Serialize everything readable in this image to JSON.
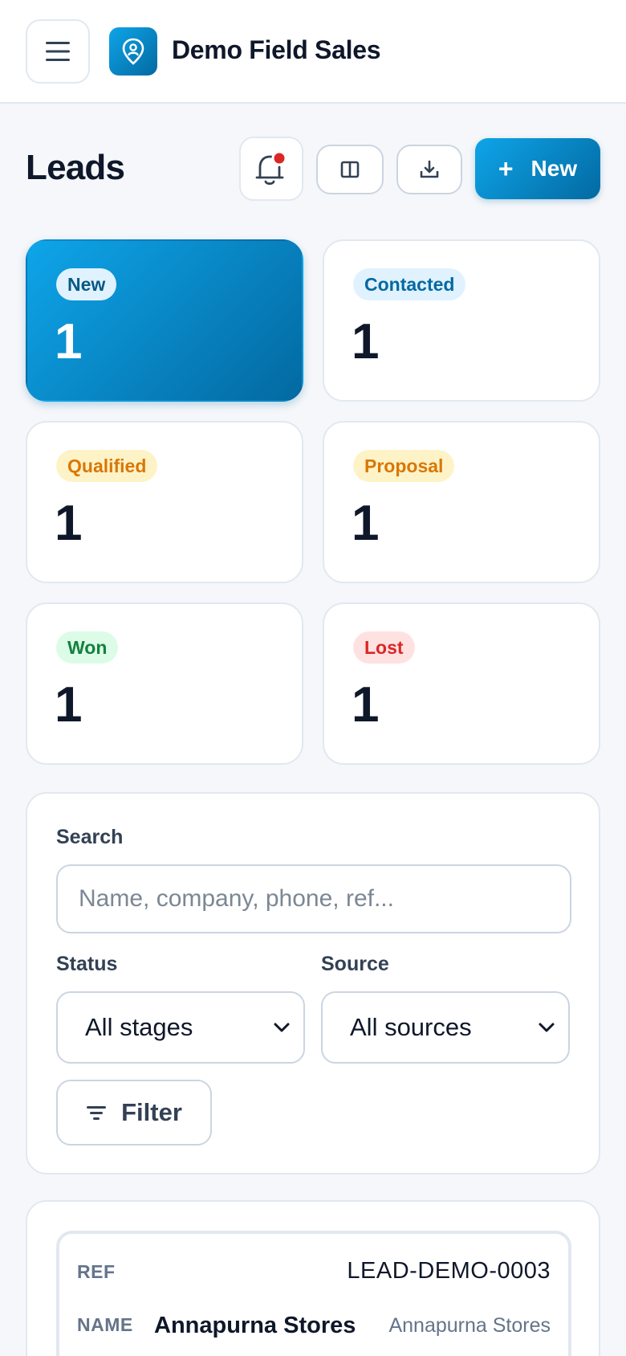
{
  "app": {
    "title": "Demo Field Sales"
  },
  "header": {
    "title": "Leads",
    "new_label": "New",
    "notification_dot_color": "#dc2626"
  },
  "stats": [
    {
      "label": "New",
      "value": "1",
      "badge_bg": "#e0f2fe",
      "badge_color": "#075985",
      "active": true
    },
    {
      "label": "Contacted",
      "value": "1",
      "badge_bg": "#e0f2fe",
      "badge_color": "#0369a1",
      "active": false
    },
    {
      "label": "Qualified",
      "value": "1",
      "badge_bg": "#fef3c7",
      "badge_color": "#d97706",
      "active": false
    },
    {
      "label": "Proposal",
      "value": "1",
      "badge_bg": "#fef3c7",
      "badge_color": "#d97706",
      "active": false
    },
    {
      "label": "Won",
      "value": "1",
      "badge_bg": "#dcfce7",
      "badge_color": "#15803d",
      "active": false
    },
    {
      "label": "Lost",
      "value": "1",
      "badge_bg": "#fee2e2",
      "badge_color": "#dc2626",
      "active": false
    }
  ],
  "filters": {
    "search_label": "Search",
    "search_placeholder": "Name, company, phone, ref...",
    "status_label": "Status",
    "status_value": "All stages",
    "source_label": "Source",
    "source_value": "All sources",
    "filter_button": "Filter"
  },
  "leads": [
    {
      "ref_label": "REF",
      "ref": "LEAD-DEMO-0003",
      "name_label": "NAME",
      "name": "Annapurna Stores",
      "company": "Annapurna Stores"
    }
  ],
  "theme": {
    "accent": "#0284c7",
    "accent_dark": "#0369a1"
  }
}
